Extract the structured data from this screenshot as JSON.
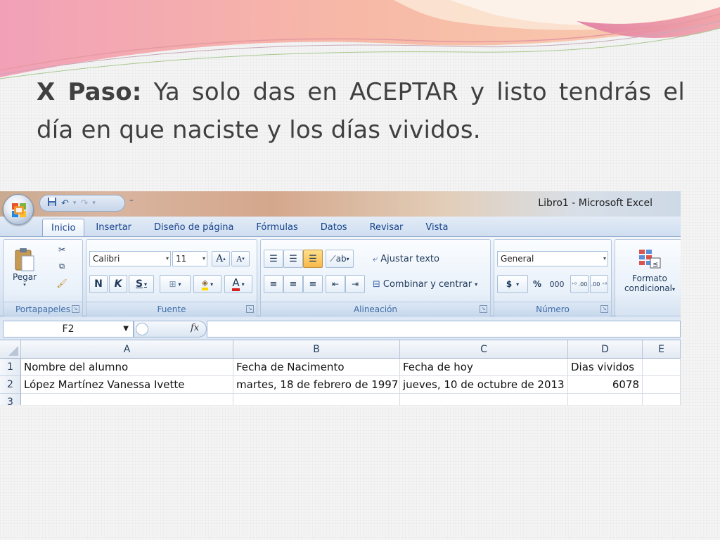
{
  "slide": {
    "title_bold": "X Paso:",
    "title_rest": " Ya solo das en ACEPTAR y listo tendrás el día en que naciste y los días vividos."
  },
  "colors": {
    "slide_text": "#404040",
    "decor_pink": "#e48aa8",
    "decor_peach": "#f6c3a4",
    "excel_blue": "#15428b"
  },
  "excel": {
    "window_title": "Libro1 - Microsoft Excel",
    "tabs": [
      "Inicio",
      "Insertar",
      "Diseño de página",
      "Fórmulas",
      "Datos",
      "Revisar",
      "Vista"
    ],
    "clipboard": {
      "label": "Portapapeles",
      "paste": "Pegar"
    },
    "font": {
      "label": "Fuente",
      "name": "Calibri",
      "size": "11",
      "bold": "N",
      "italic": "K",
      "underline": "S",
      "grow": "A",
      "shrink": "A",
      "color_a": "A"
    },
    "alignment": {
      "label": "Alineación",
      "wrap": "Ajustar texto",
      "merge": "Combinar y centrar"
    },
    "number": {
      "label": "Número",
      "format": "General",
      "currency": "$",
      "percent": "%",
      "thousands": "000",
      "inc": "⁺⁰ .00",
      "dec": ".00 ⁺⁰"
    },
    "styles": {
      "format_line1": "Formato",
      "format_line2": "condicional"
    },
    "name_box": "F2",
    "fx": "fx",
    "columns": [
      "A",
      "B",
      "C",
      "D",
      "E"
    ],
    "rows": [
      {
        "num": "1",
        "cells": [
          "Nombre del alumno",
          "Fecha de Nacimento",
          "Fecha de hoy",
          "Dias vividos"
        ]
      },
      {
        "num": "2",
        "cells": [
          "López Martínez Vanessa Ivette",
          " martes, 18 de febrero de 1997",
          " jueves, 10 de octubre de 2013",
          "6078"
        ]
      },
      {
        "num": "3",
        "cells": [
          "",
          "",
          "",
          ""
        ]
      }
    ]
  }
}
